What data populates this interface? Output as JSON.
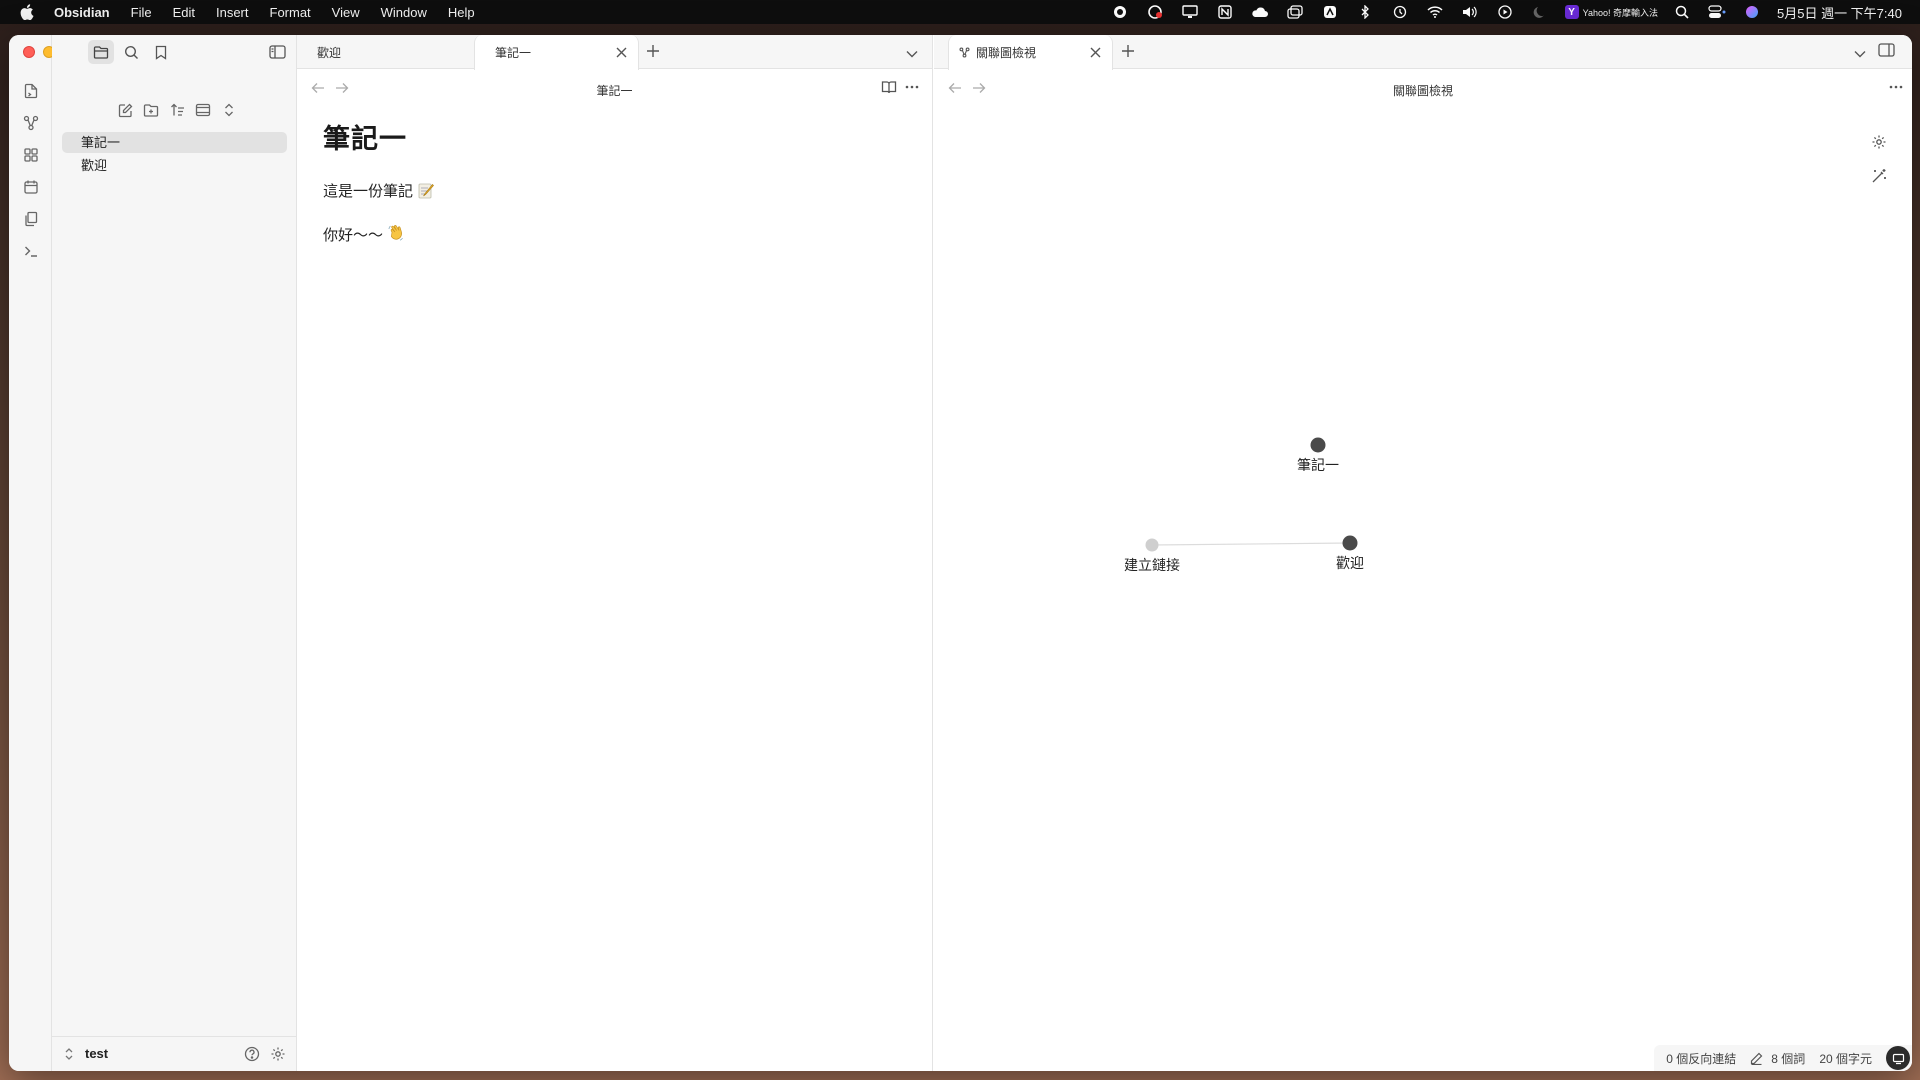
{
  "menubar": {
    "app_name": "Obsidian",
    "menus": [
      "File",
      "Edit",
      "Insert",
      "Format",
      "View",
      "Window",
      "Help"
    ],
    "ime_label": "Yahoo! 奇摩輸入法",
    "clock": "5月5日 週一 下午7:40"
  },
  "sidebar": {
    "files": [
      {
        "name": "筆記一",
        "active": true
      },
      {
        "name": "歡迎",
        "active": false
      }
    ],
    "vault_name": "test"
  },
  "left_pane": {
    "tabs": [
      {
        "label": "歡迎",
        "active": false
      },
      {
        "label": "筆記一",
        "active": true
      }
    ],
    "view_title": "筆記一",
    "doc": {
      "heading": "筆記一",
      "paragraphs": [
        "這是一份筆記",
        "你好～～"
      ],
      "emoji_names": [
        "memo-emoji",
        "waving-hand-emoji"
      ]
    }
  },
  "right_pane": {
    "tabs": [
      {
        "label": "關聯圖檢視",
        "active": true,
        "icon": "graph-icon"
      }
    ],
    "view_title": "關聯圖檢視",
    "graph": {
      "nodes": [
        {
          "id": "n1",
          "label": "筆記一",
          "state": "existing"
        },
        {
          "id": "n2",
          "label": "建立鏈接",
          "state": "unresolved"
        },
        {
          "id": "n3",
          "label": "歡迎",
          "state": "existing"
        }
      ],
      "edges": [
        [
          "n2",
          "n3"
        ]
      ]
    }
  },
  "statusbar": {
    "backlinks": "0 個反向連結",
    "words": "8 個詞",
    "chars": "20 個字元"
  },
  "colors": {
    "accent_active_bg": "#e2e2e2",
    "node_existing": "#4a4a4a",
    "node_unresolved": "#cfcfcf"
  }
}
